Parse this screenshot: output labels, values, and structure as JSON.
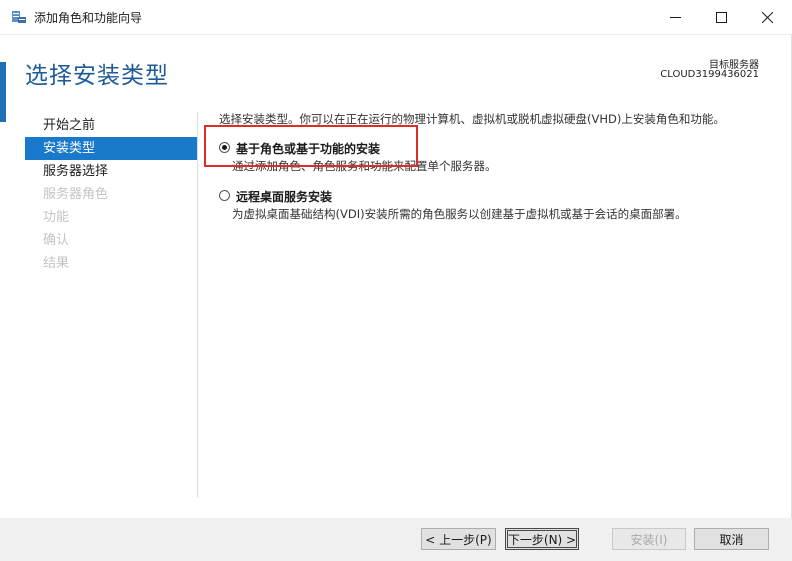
{
  "window": {
    "title": "添加角色和功能向导",
    "icon": "server-manager-icon"
  },
  "header": {
    "page_title": "选择安装类型",
    "target_label": "目标服务器",
    "target_name": "CLOUD3199436021"
  },
  "nav": {
    "items": [
      {
        "label": "开始之前",
        "state": "normal"
      },
      {
        "label": "安装类型",
        "state": "active"
      },
      {
        "label": "服务器选择",
        "state": "normal"
      },
      {
        "label": "服务器角色",
        "state": "disabled"
      },
      {
        "label": "功能",
        "state": "disabled"
      },
      {
        "label": "确认",
        "state": "disabled"
      },
      {
        "label": "结果",
        "state": "disabled"
      }
    ]
  },
  "content": {
    "intro": "选择安装类型。你可以在正在运行的物理计算机、虚拟机或脱机虚拟硬盘(VHD)上安装角色和功能。",
    "options": [
      {
        "label": "基于角色或基于功能的安装",
        "description": "通过添加角色、角色服务和功能来配置单个服务器。",
        "selected": true
      },
      {
        "label": "远程桌面服务安装",
        "description": "为虚拟桌面基础结构(VDI)安装所需的角色服务以创建基于虚拟机或基于会话的桌面部署。",
        "selected": false
      }
    ]
  },
  "footer": {
    "prev_label": "< 上一步(P)",
    "next_label": "下一步(N) >",
    "install_label": "安装(I)",
    "cancel_label": "取消"
  },
  "colors": {
    "title_blue": "#1e5a9a",
    "nav_active": "#1979ca",
    "highlight_red": "#e02b2b"
  }
}
